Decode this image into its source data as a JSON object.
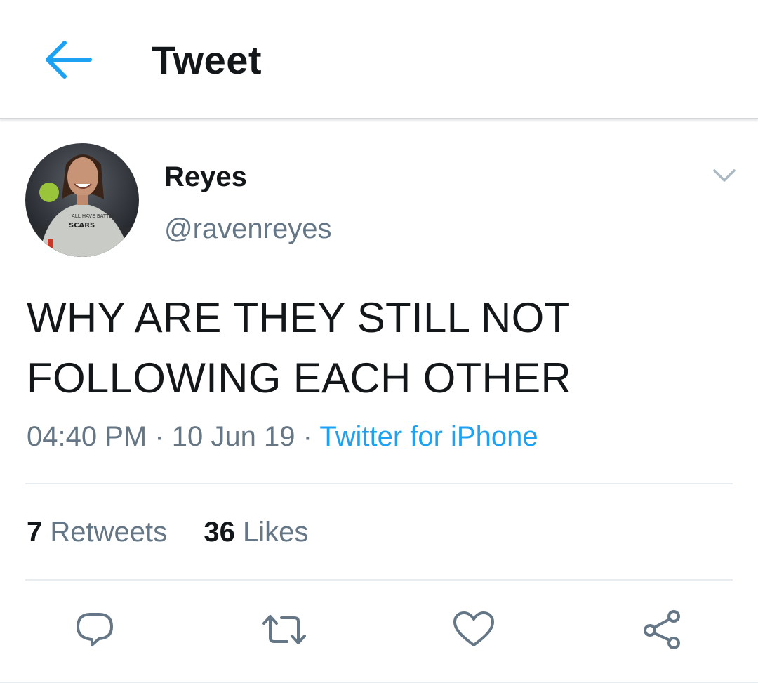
{
  "header": {
    "title": "Tweet",
    "back_icon": "back-arrow-icon"
  },
  "tweet": {
    "author": {
      "display_name": "Reyes",
      "handle": "@ravenreyes",
      "avatar": "user-avatar-photo"
    },
    "text_line1": "WHY ARE THEY STILL NOT",
    "text_line2": "FOLLOWING EACH OTHER",
    "time": "04:40 PM",
    "separator": "·",
    "date": "10 Jun 19",
    "source": "Twitter for iPhone",
    "stats": {
      "retweets_count": "7",
      "retweets_label": "Retweets",
      "likes_count": "36",
      "likes_label": "Likes"
    },
    "actions": [
      "reply-icon",
      "retweet-icon",
      "like-icon",
      "share-icon"
    ]
  },
  "colors": {
    "accent": "#1da1f2",
    "text_primary": "#14171a",
    "text_secondary": "#657786",
    "divider": "#e6ecf0"
  }
}
